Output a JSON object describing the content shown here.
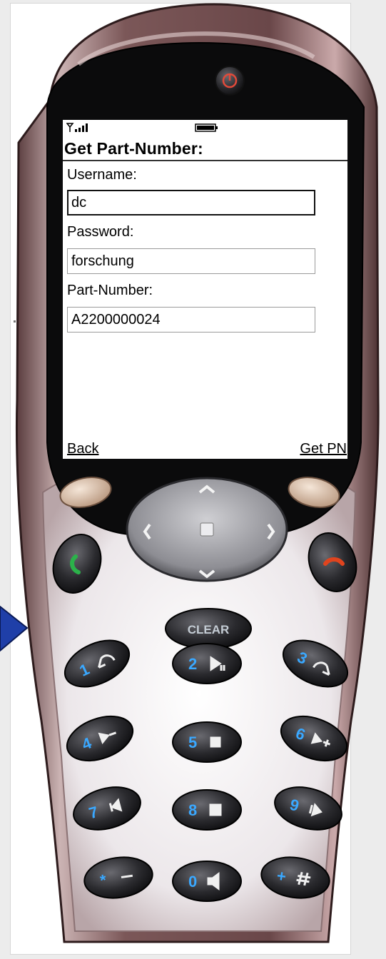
{
  "screen": {
    "title": "Get Part-Number:",
    "fields": [
      {
        "label": "Username:",
        "value": "dc",
        "focused": true
      },
      {
        "label": "Password:",
        "value": "forschung",
        "focused": false
      },
      {
        "label": "Part-Number:",
        "value": "A2200000024",
        "focused": false
      }
    ],
    "softkeys": {
      "left": "Back",
      "right": "Get PN"
    }
  },
  "keypad": {
    "clear": "CLEAR",
    "keys": [
      {
        "digit": "1",
        "icon": "undo-icon"
      },
      {
        "digit": "2",
        "icon": "play-pause-icon"
      },
      {
        "digit": "3",
        "icon": "redo-icon"
      },
      {
        "digit": "4",
        "icon": "step-minus-icon"
      },
      {
        "digit": "5",
        "icon": "stop-icon"
      },
      {
        "digit": "6",
        "icon": "step-plus-icon"
      },
      {
        "digit": "7",
        "icon": "rewind-icon"
      },
      {
        "digit": "8",
        "icon": "grid-icon"
      },
      {
        "digit": "9",
        "icon": "forward-icon"
      },
      {
        "digit": "*",
        "icon": "minus-icon"
      },
      {
        "digit": "0",
        "icon": "speaker-icon"
      },
      {
        "digit": "+",
        "icon": "hash-icon"
      }
    ]
  },
  "colors": {
    "body": "#6e4c4d",
    "body_highlight": "#c9b0b0",
    "faceplate": "#f1eef0",
    "key": "#2c2c30",
    "key_label": "#3aa8ff",
    "call_green": "#2bb24a",
    "end_red": "#e0441e",
    "arrow": "#1f3fa8"
  }
}
